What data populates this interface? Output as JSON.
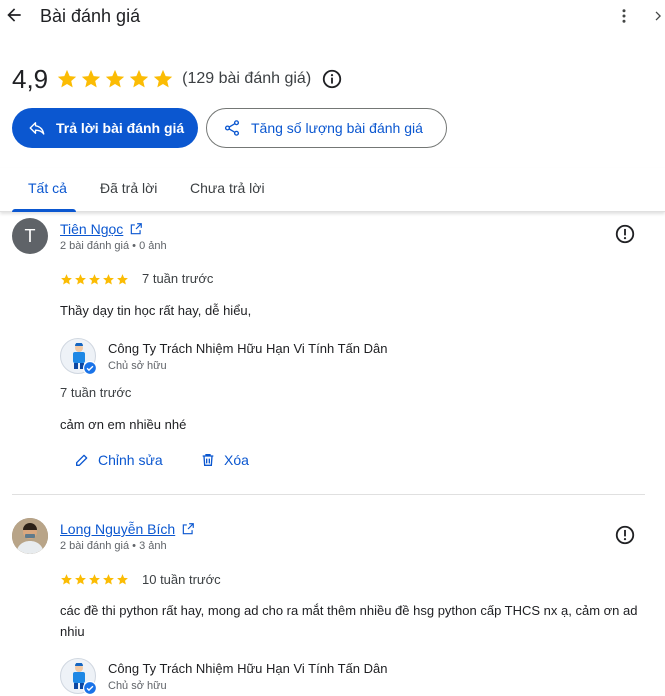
{
  "header": {
    "title": "Bài đánh giá"
  },
  "summary": {
    "rating": "4,9",
    "star_count": 5,
    "review_count": "(129 bài đánh giá)"
  },
  "buttons": {
    "reply": "Trả lời bài đánh giá",
    "increase": "Tăng số lượng bài đánh giá"
  },
  "tabs": [
    "Tất cả",
    "Đã trả lời",
    "Chưa trả lời"
  ],
  "colors": {
    "accent": "#0b57d0",
    "star": "#fbbc04",
    "avatar_gray": "#5f6368"
  },
  "reviews": [
    {
      "avatar_letter": "T",
      "name": "Tiên Ngọc",
      "meta": "2 bài đánh giá • 0 ảnh",
      "stars": 5,
      "when": "7 tuần trước",
      "text": "Thầy dạy tin học rất hay, dễ hiểu,",
      "owner_name": "Công Ty Trách Nhiệm Hữu Hạn Vi Tính Tấn Dân",
      "owner_role": "Chủ sở hữu",
      "reply_when": "7 tuần trước",
      "reply_text": "cảm ơn em nhiều nhé",
      "edit_label": "Chỉnh sửa",
      "delete_label": "Xóa"
    },
    {
      "name": "Long Nguyễn Bích",
      "meta": "2 bài đánh giá • 3 ảnh",
      "stars": 5,
      "when": "10 tuần trước",
      "text": "các đề thi python rất hay, mong ad cho ra mắt thêm nhiều đề hsg python cấp THCS nx ạ, cảm ơn ad nhiu",
      "owner_name": "Công Ty Trách Nhiệm Hữu Hạn Vi Tính Tấn Dân",
      "owner_role": "Chủ sở hữu"
    }
  ]
}
